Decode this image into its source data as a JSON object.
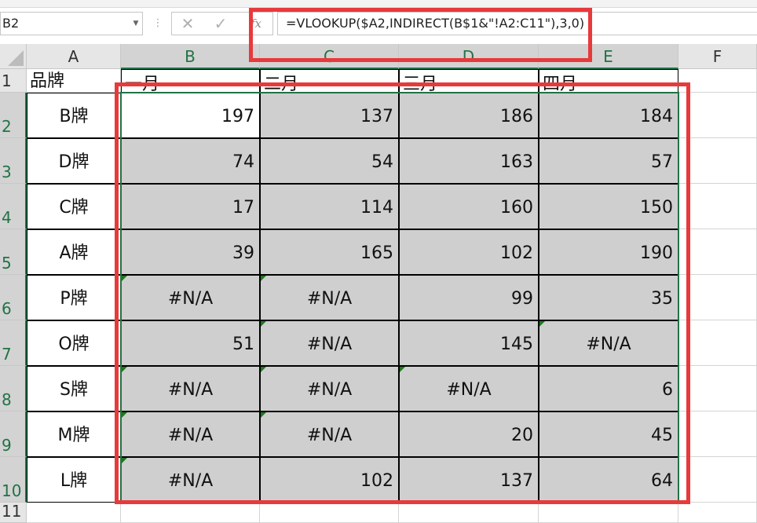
{
  "formula_bar": {
    "name_box": "B2",
    "formula": "=VLOOKUP($A2,INDIRECT(B$1&\"!A2:C11\"),3,0)",
    "cancel_icon": "✕",
    "enter_icon": "✓",
    "fx_icon": "fx",
    "dots": "⋮",
    "dropdown": "▼"
  },
  "columns": [
    "A",
    "B",
    "C",
    "D",
    "E",
    "F"
  ],
  "rows": [
    "1",
    "2",
    "3",
    "4",
    "5",
    "6",
    "7",
    "8",
    "9",
    "10",
    "11"
  ],
  "header_row": [
    "品牌",
    "一月",
    "二月",
    "三月",
    "四月"
  ],
  "brands": [
    "B牌",
    "D牌",
    "C牌",
    "A牌",
    "P牌",
    "O牌",
    "S牌",
    "M牌",
    "L牌"
  ],
  "table": [
    [
      "197",
      "137",
      "186",
      "184"
    ],
    [
      "74",
      "54",
      "163",
      "57"
    ],
    [
      "17",
      "114",
      "160",
      "150"
    ],
    [
      "39",
      "165",
      "102",
      "190"
    ],
    [
      "#N/A",
      "#N/A",
      "99",
      "35"
    ],
    [
      "51",
      "#N/A",
      "145",
      "#N/A"
    ],
    [
      "#N/A",
      "#N/A",
      "#N/A",
      "6"
    ],
    [
      "#N/A",
      "#N/A",
      "20",
      "45"
    ],
    [
      "#N/A",
      "102",
      "137",
      "64"
    ]
  ],
  "colors": {
    "selection": "#217346",
    "annotation_red": "#e8393b",
    "cell_grey": "#cfcfcf",
    "error_triangle": "#1e7a1e"
  }
}
